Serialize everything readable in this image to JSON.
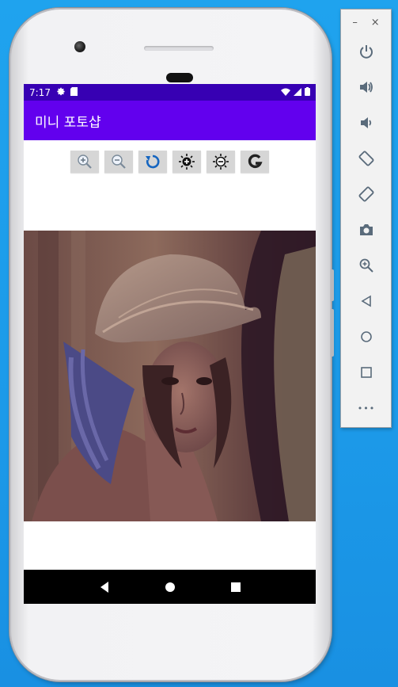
{
  "status_bar": {
    "time": "7:17",
    "left_icons": [
      "settings-gear-icon",
      "sd-card-icon"
    ],
    "right_icons": [
      "wifi-icon",
      "cell-signal-icon",
      "battery-icon"
    ]
  },
  "app": {
    "title": "미니 포토샵",
    "toolbar": [
      {
        "name": "zoom-in-button",
        "icon": "zoom-in-icon"
      },
      {
        "name": "zoom-out-button",
        "icon": "zoom-out-icon"
      },
      {
        "name": "rotate-button",
        "icon": "rotate-icon"
      },
      {
        "name": "brightness-up-button",
        "icon": "brightness-up-icon"
      },
      {
        "name": "brightness-down-button",
        "icon": "brightness-down-icon"
      },
      {
        "name": "grayscale-button",
        "icon": "grayscale-g-icon"
      }
    ],
    "image_description_icon": "photo-image"
  },
  "nav_bar": [
    "back-button",
    "home-button",
    "recents-button"
  ],
  "emulator_panel": {
    "minimize_label": "–",
    "close_label": "×",
    "buttons": [
      "power-icon",
      "volume-up-icon",
      "volume-down-icon",
      "rotate-left-icon",
      "rotate-right-icon",
      "camera-icon",
      "zoom-icon",
      "back-icon",
      "home-icon",
      "overview-icon",
      "more-icon"
    ],
    "more_label": "•••"
  },
  "colors": {
    "status_bar": "#3700b3",
    "app_bar": "#6200ee",
    "desktop": "#1fa3ee",
    "toolbar_button": "#d6d6d6"
  }
}
